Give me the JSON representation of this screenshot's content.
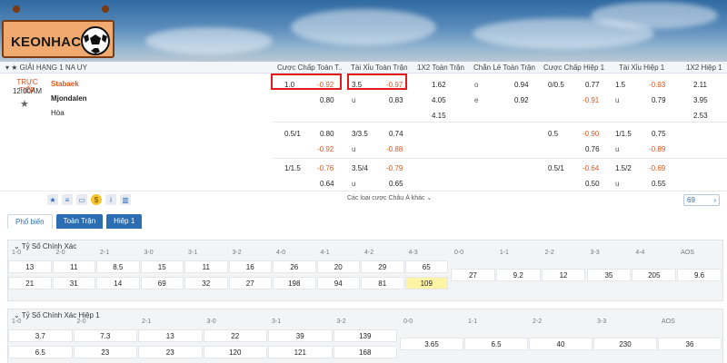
{
  "brand": {
    "logo_text": "KEONHACAI"
  },
  "league": {
    "name": "GIẢI HẠNG 1 NA UY"
  },
  "columns": [
    "Cược Chấp Toàn T...",
    "Tài Xỉu Toàn Trận",
    "1X2 Toàn Trận",
    "Chẵn Lẻ Toàn Trận",
    "Cược Chấp Hiệp 1",
    "Tài Xỉu Hiệp 1",
    "1X2 Hiệp 1"
  ],
  "match": {
    "status": "TRỰC TIẾP",
    "time": "12:00AM",
    "home": "Stabaek",
    "away": "Mjondalen",
    "draw": "Hòa"
  },
  "odds": {
    "r1": {
      "hc_line": "1.0",
      "hc_home": "-0.92",
      "hc_away": "0.80",
      "ou_line": "3.5",
      "ou_over": "-0.97",
      "ou_u": "u",
      "ou_under": "0.83",
      "x1": "1.62",
      "x2": "4.05",
      "xd": "4.15",
      "oe_o": "o",
      "oe_ov": "0.94",
      "oe_e": "e",
      "oe_ev": "0.92",
      "h1hc_line": "0/0.5",
      "h1hc_home": "0.77",
      "h1hc_away": "-0.91",
      "h1ou_line": "1.5",
      "h1ou_over": "-0.93",
      "h1ou_u": "u",
      "h1ou_under": "0.79",
      "h1x1": "2.11",
      "h1x2": "3.95",
      "h1xd": "2.53"
    },
    "r2": {
      "hc_line": "0.5/1",
      "hc_home": "0.80",
      "hc_away": "-0.92",
      "ou_line": "3/3.5",
      "ou_over": "0.74",
      "ou_u": "u",
      "ou_under": "-0.88",
      "h1hc_line": "0.5",
      "h1hc_home": "-0.90",
      "h1hc_away": "0.76",
      "h1ou_line": "1/1.5",
      "h1ou_over": "0.75",
      "h1ou_u": "u",
      "h1ou_under": "-0.89"
    },
    "r3": {
      "hc_line": "1/1.5",
      "hc_home": "-0.76",
      "hc_away": "0.64",
      "ou_line": "3.5/4",
      "ou_over": "-0.79",
      "ou_u": "u",
      "ou_under": "0.65",
      "h1hc_line": "0.5/1",
      "h1hc_home": "-0.64",
      "h1hc_away": "0.50",
      "h1ou_line": "1.5/2",
      "h1ou_over": "-0.69",
      "h1ou_u": "u",
      "h1ou_under": "0.55"
    }
  },
  "more_link": "Các loại cược Châu Á khác",
  "page_count": "69",
  "tabs": [
    "Phổ biến",
    "Toàn Trận",
    "Hiệp 1"
  ],
  "correct_score": {
    "title": "Tỷ Số Chính Xác",
    "home_labels": [
      "1-0",
      "2-0",
      "2-1",
      "3-0",
      "3-1",
      "3-2",
      "4-0",
      "4-1",
      "4-2",
      "4-3"
    ],
    "home_values": [
      "13",
      "11",
      "8.5",
      "15",
      "11",
      "16",
      "26",
      "20",
      "29",
      "65"
    ],
    "away_values": [
      "21",
      "31",
      "14",
      "69",
      "32",
      "27",
      "198",
      "94",
      "81",
      "109"
    ],
    "draw_labels": [
      "0-0",
      "1-1",
      "2-2",
      "3-3",
      "4-4",
      "AOS"
    ],
    "draw_values": [
      "27",
      "9.2",
      "12",
      "35",
      "205",
      "9.6"
    ]
  },
  "correct_score_h1": {
    "title": "Tỷ Số Chính Xác Hiệp 1",
    "home_labels": [
      "1-0",
      "2-0",
      "2-1",
      "3-0",
      "3-1",
      "3-2"
    ],
    "home_values": [
      "3.7",
      "7.3",
      "13",
      "22",
      "39",
      "139"
    ],
    "away_values": [
      "6.5",
      "23",
      "23",
      "120",
      "121",
      "168"
    ],
    "draw_labels": [
      "0-0",
      "1-1",
      "2-2",
      "3-3",
      "AOS"
    ],
    "draw_values": [
      "3.65",
      "6.5",
      "40",
      "230",
      "36"
    ]
  }
}
